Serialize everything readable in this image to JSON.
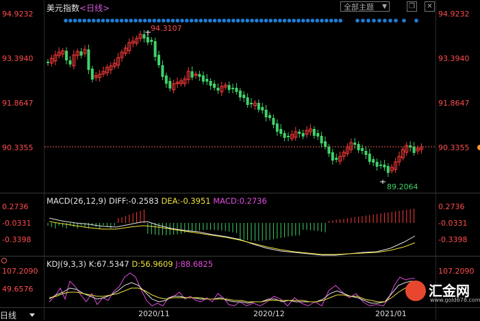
{
  "header": {
    "title": "美元指数",
    "period_label": "<日线>",
    "theme_label": "全部主题",
    "theme_arrow": "▼",
    "restore_icon": "❐",
    "close_icon": "✕"
  },
  "price_panel": {
    "y_labels": [
      "94.9232",
      "93.3940",
      "91.8647",
      "90.3355"
    ],
    "high_label": "94.3107",
    "low_label": "89.2064",
    "ref_line_value": "90.3355",
    "colors": {
      "up": "#ff3b3b",
      "down": "#3fd36a",
      "ref": "#ff5a5a",
      "dots": "#1e7fd8"
    }
  },
  "macd_panel": {
    "label": "MACD(26,12,9)",
    "diff": "DIFF:-0.2583",
    "dea": "DEA:-0.3951",
    "macd": "MACD:0.2736",
    "y_labels": [
      "0.2736",
      "-0.0331",
      "-0.3398"
    ]
  },
  "kdj_panel": {
    "label": "KDJ(9,3,3)",
    "k": "K:67.5347",
    "d": "D:56.9609",
    "j": "J:88.6825",
    "y_labels": [
      "107.2090",
      "49.6576"
    ]
  },
  "x_axis": [
    "2020/11",
    "2020/12",
    "2021/01"
  ],
  "footer": {
    "period_tab": "日线"
  },
  "watermark": {
    "brand": "汇金网",
    "url": "www.gold678.com"
  }
}
